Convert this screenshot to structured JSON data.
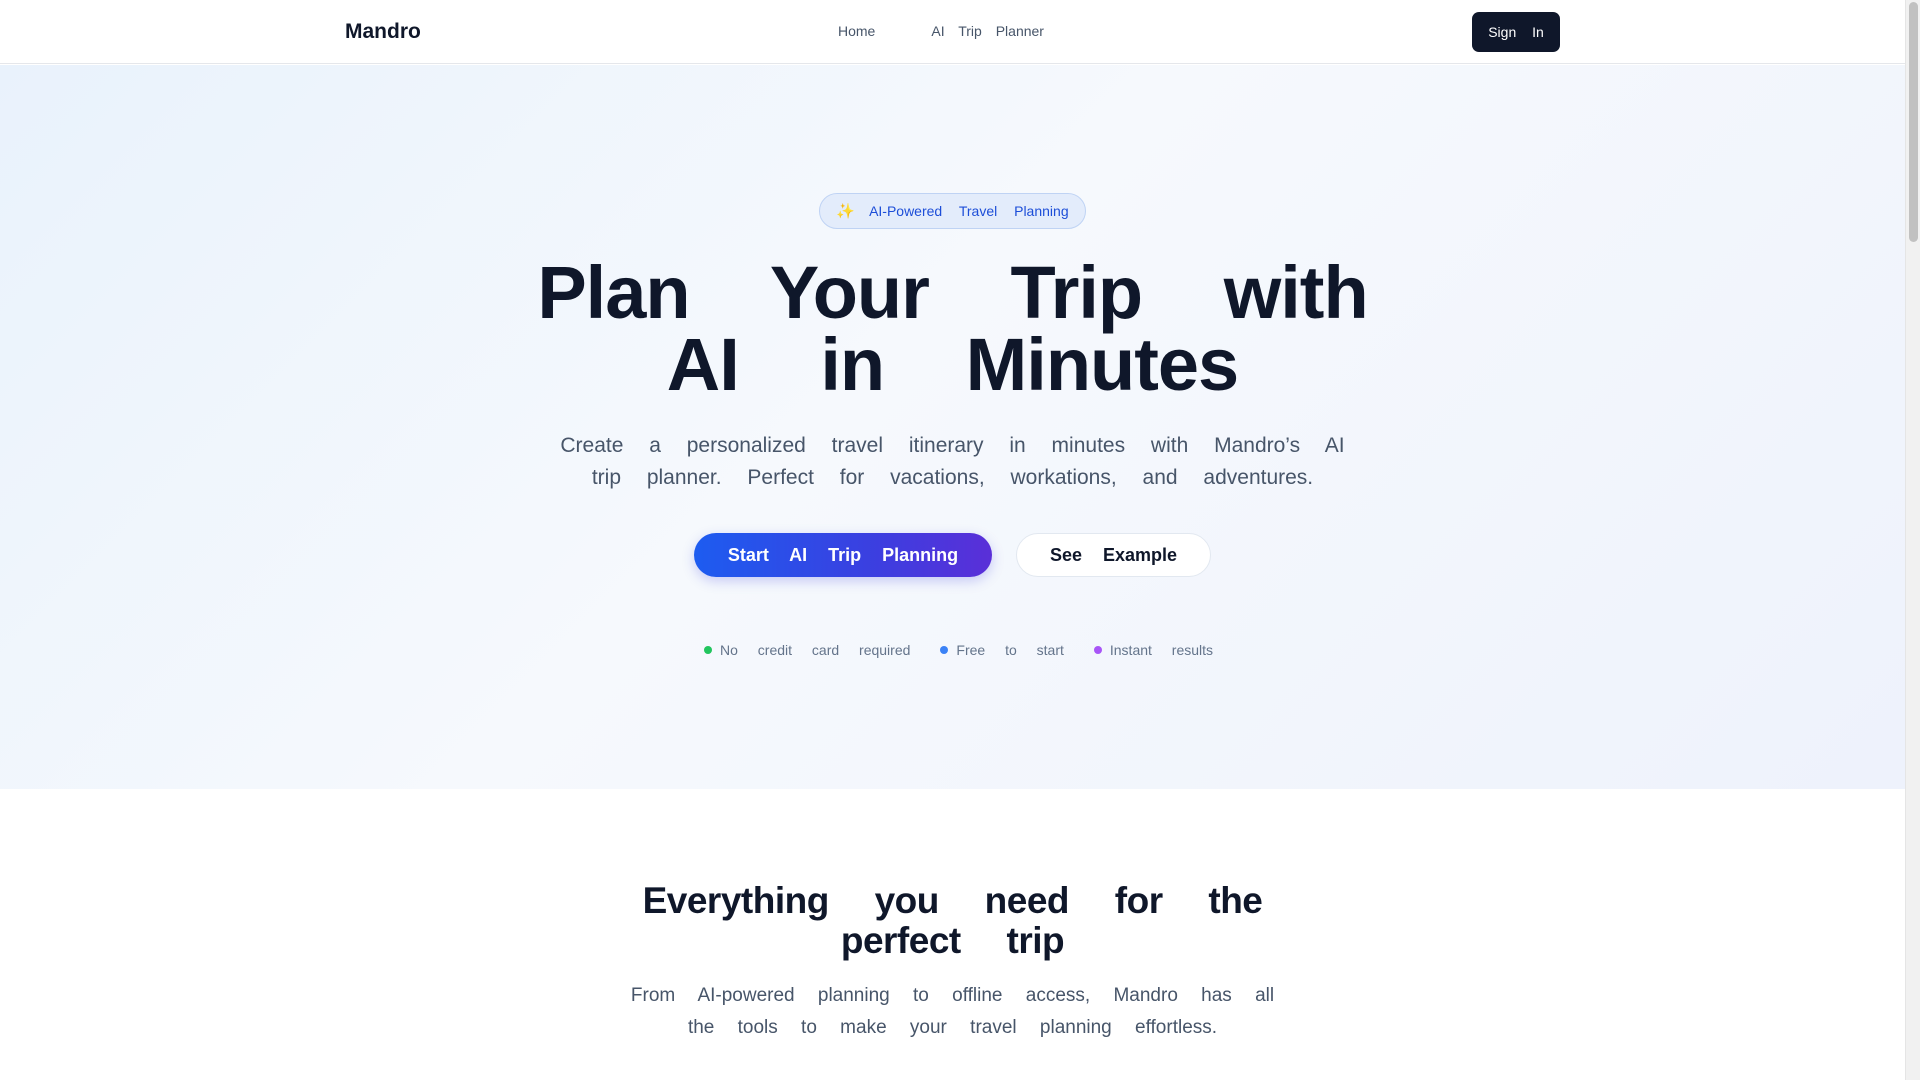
{
  "header": {
    "logo": "Mandro",
    "nav": {
      "home": "Home",
      "ai_trip_planner": "AI Trip Planner"
    },
    "sign_in": "Sign In"
  },
  "hero": {
    "badge_icon": "sparkles-icon",
    "badge_text": "AI-Powered Travel Planning",
    "title": "Plan Your Trip with AI in Minutes",
    "subtitle": "Create a personalized travel itinerary in minutes with Mandro’s AI trip planner. Perfect for vacations, workations, and adventures.",
    "primary_cta": "Start AI Trip Planning",
    "secondary_cta": "See Example",
    "perks": [
      {
        "label": "No credit card required",
        "color": "#22c55e"
      },
      {
        "label": "Free to start",
        "color": "#3b82f6"
      },
      {
        "label": "Instant results",
        "color": "#a855f7"
      }
    ]
  },
  "features": {
    "title": "Everything you need for the perfect trip",
    "subtitle": "From AI-powered planning to offline access, Mandro has all the tools to make your travel planning effortless."
  },
  "colors": {
    "primary_gradient_start": "#1d5cf0",
    "primary_gradient_end": "#5a2fd8",
    "dark": "#0f172a",
    "badge_text": "#1d4ed8"
  }
}
